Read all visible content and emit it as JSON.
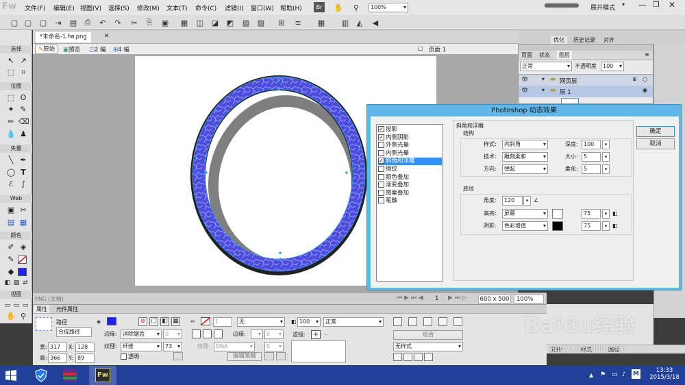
{
  "app": {
    "logo": "Fw",
    "menu": [
      "文件(F)",
      "编辑(E)",
      "视图(V)",
      "选择(S)",
      "修改(M)",
      "文本(T)",
      "命令(C)",
      "滤镜(I)",
      "窗口(W)",
      "帮助(H)"
    ],
    "br": "Br",
    "zoom": "100%",
    "workspace": "展开模式"
  },
  "document": {
    "tab": "*未命名-1.fw.png",
    "views": [
      "原始",
      "预览",
      "2 幅",
      "4 幅"
    ],
    "page": "页面 1",
    "status_left": "PNG (文档)",
    "page_num": "1",
    "size": "600 x 500",
    "zoom": "100%"
  },
  "tools": {
    "select": "选择",
    "bitmap": "位图",
    "vector": "矢量",
    "web": "Web",
    "colors": "颜色",
    "view": "视图"
  },
  "panel": {
    "tabs_top": [
      "优化",
      "历史记录",
      "对齐"
    ],
    "tabs": [
      "页面",
      "状态",
      "图层"
    ],
    "blend": "正常",
    "opacity_label": "不透明度",
    "opacity": "100",
    "layers": [
      "网页层",
      "层 1"
    ],
    "bottom_tabs": [
      "元件",
      "样式",
      "图层"
    ]
  },
  "dialog": {
    "title": "Photoshop 动态效果",
    "effects": [
      {
        "label": "投影",
        "checked": true
      },
      {
        "label": "内侧阴影",
        "checked": true
      },
      {
        "label": "外侧光晕",
        "checked": false
      },
      {
        "label": "内侧光晕",
        "checked": false
      },
      {
        "label": "斜角和浮雕",
        "checked": true
      },
      {
        "label": "缎纹",
        "checked": false
      },
      {
        "label": "颜色叠加",
        "checked": false
      },
      {
        "label": "渐变叠加",
        "checked": false
      },
      {
        "label": "图案叠加",
        "checked": false
      },
      {
        "label": "笔触",
        "checked": false
      }
    ],
    "section": "斜角和浮雕",
    "structure": {
      "title": "结构",
      "style_label": "样式:",
      "style": "内斜角",
      "tech_label": "技术:",
      "tech": "雕刻柔和",
      "dir_label": "方向:",
      "dir": "弹起",
      "depth_label": "深度:",
      "depth": "100",
      "size_label": "大小:",
      "size": "5",
      "soften_label": "柔化:",
      "soften": "5"
    },
    "shading": {
      "title": "底纹",
      "angle_label": "角度:",
      "angle": "120",
      "highlight_label": "高亮:",
      "highlight_mode": "屏幕",
      "highlight_opacity": "75",
      "shadow_label": "阴影:",
      "shadow_mode": "色彩增值",
      "shadow_opacity": "75"
    },
    "ok": "确定",
    "cancel": "取消"
  },
  "props": {
    "tabs": [
      "属性",
      "元件属性"
    ],
    "type": "路径",
    "name": "合成路径",
    "w_label": "宽:",
    "w": "317",
    "x_label": "X:",
    "x": "128",
    "h_label": "高:",
    "h": "366",
    "y_label": "Y:",
    "y": "89",
    "edge_label": "边缘:",
    "edge": "消除锯齿",
    "edge_val": "0",
    "texture_label": "纹理:",
    "texture": "纤维",
    "texture_val": "73",
    "transparent": "透明",
    "stroke_size": "1",
    "stroke": "无",
    "edge2_label": "边缘:",
    "edge2_val": "0",
    "texture2_label": "纹理:",
    "texture2": "DNA",
    "texture2_val": "0",
    "edit_stroke": "编辑笔触",
    "opacity": "100",
    "blend": "正常",
    "filters_label": "滤镜:",
    "group": "组合",
    "style": "无样式"
  },
  "taskbar": {
    "time": "13:33",
    "date": "2015/3/18",
    "ime": "M"
  },
  "watermark": {
    "brand": "Baidu经验",
    "url": "jingyan.baidu.com"
  },
  "colors": {
    "dialog_title": "#5eb7e8",
    "ring": "#4a4de0",
    "taskbar": "#20409a",
    "fill_swatch": "#2020ff"
  }
}
